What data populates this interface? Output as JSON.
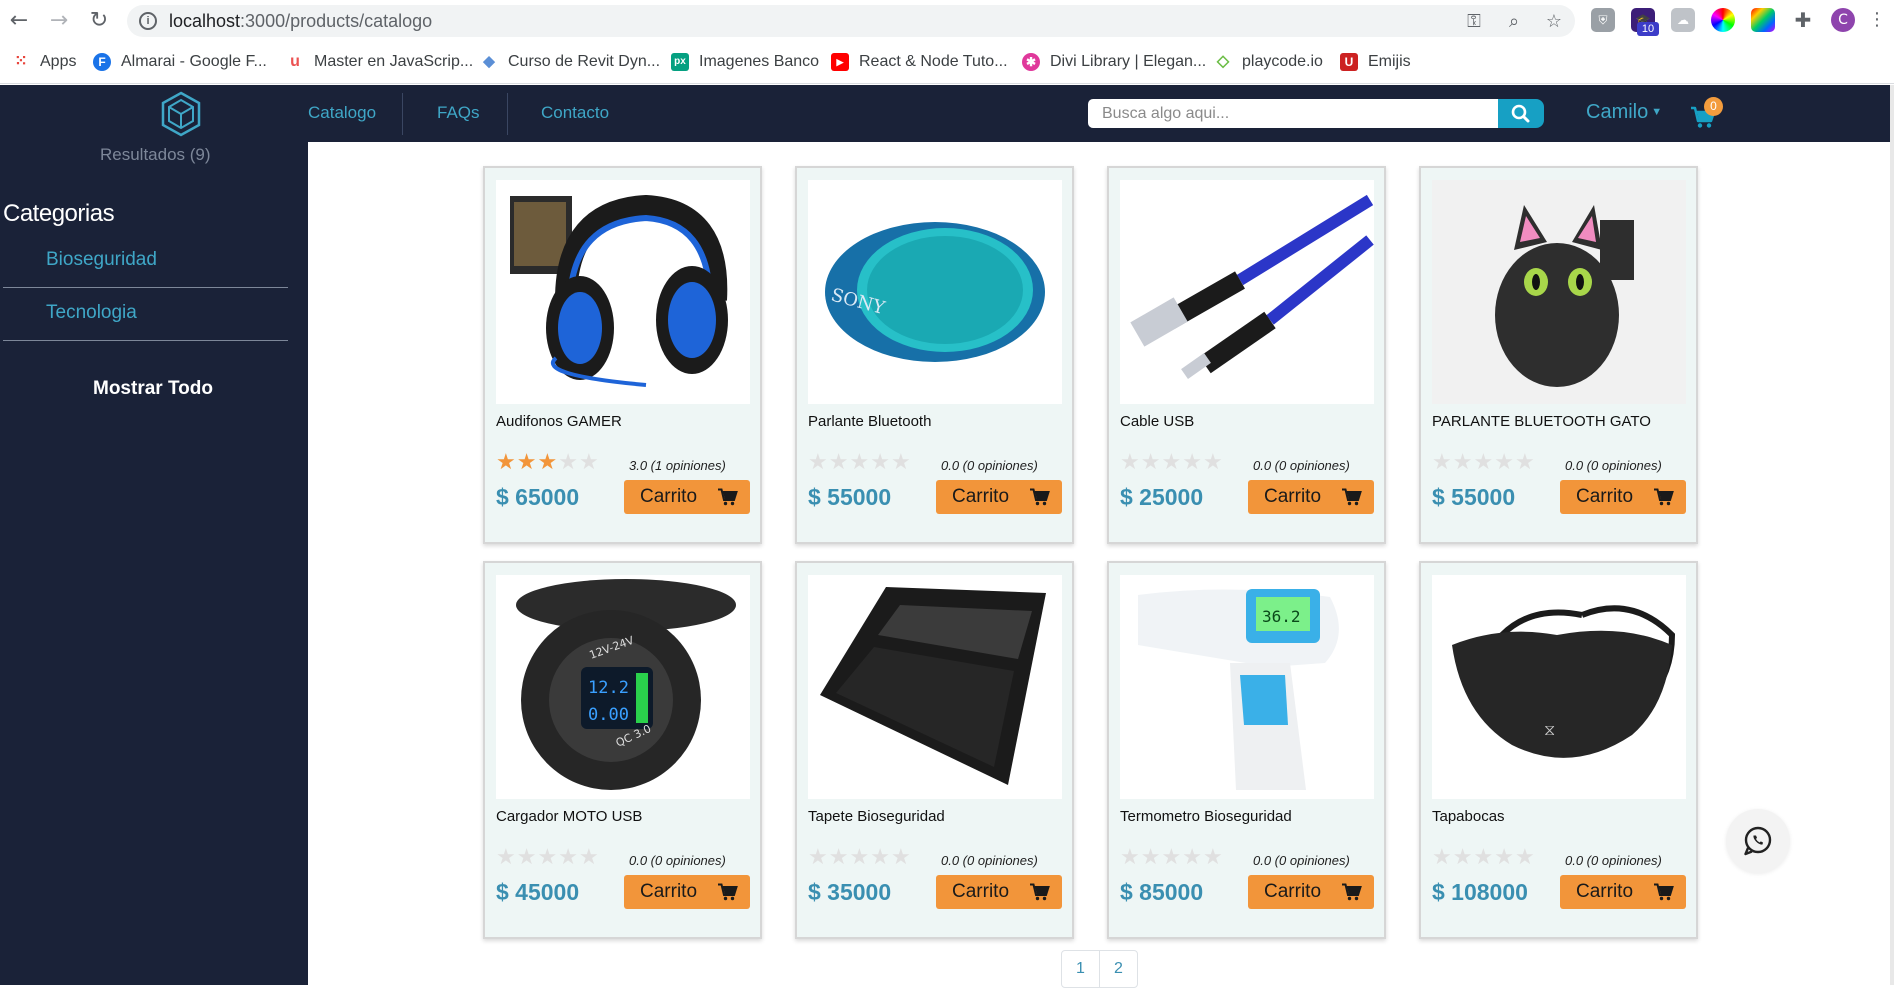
{
  "browser": {
    "url_host": "localhost",
    "url_path": ":3000/products/catalogo",
    "extension_badge": "10",
    "profile_initial": "C"
  },
  "bookmarks": [
    {
      "label": "Apps",
      "icon": "apps-grid-icon"
    },
    {
      "label": "Almarai - Google F...",
      "icon": "google-fonts-icon",
      "glyph": "F",
      "color": "#1a73e8"
    },
    {
      "label": "Master en JavaScrip...",
      "icon": "udemy-icon",
      "glyph": "u",
      "color": "#ec5252"
    },
    {
      "label": "Curso de Revit Dyn...",
      "icon": "dynamo-icon",
      "glyph": "◆",
      "color": "#5b8fd6"
    },
    {
      "label": "Imagenes Banco",
      "icon": "pexels-icon",
      "glyph": "px",
      "color": "#05a081"
    },
    {
      "label": "React & Node Tuto...",
      "icon": "youtube-icon",
      "glyph": "▶",
      "color": "#ff0000"
    },
    {
      "label": "Divi Library | Elegan...",
      "icon": "divi-icon",
      "glyph": "✱",
      "color": "#e0389b"
    },
    {
      "label": "playcode.io",
      "icon": "playcode-icon",
      "glyph": "◇",
      "color": "#6bbd45"
    },
    {
      "label": "Emijis",
      "icon": "unicode-icon",
      "glyph": "U",
      "color": "#d33"
    }
  ],
  "header": {
    "menu": [
      "Catalogo",
      "FAQs",
      "Contacto"
    ],
    "search_placeholder": "Busca algo aqui...",
    "user": "Camilo",
    "cart_count": "0"
  },
  "sidebar": {
    "results": "Resultados (9)",
    "title": "Categorias",
    "categories": [
      "Bioseguridad",
      "Tecnologia"
    ],
    "show_all": "Mostrar Todo"
  },
  "products": [
    {
      "name": "Audifonos GAMER",
      "rating_value": 3,
      "rating_text": "3.0 (1 opiniones)",
      "price": "$ 65000",
      "button": "Carrito",
      "image": "headset"
    },
    {
      "name": "Parlante Bluetooth",
      "rating_value": 0,
      "rating_text": "0.0 (0 opiniones)",
      "price": "$ 55000",
      "button": "Carrito",
      "image": "speaker"
    },
    {
      "name": "Cable USB",
      "rating_value": 0,
      "rating_text": "0.0 (0 opiniones)",
      "price": "$ 25000",
      "button": "Carrito",
      "image": "cable"
    },
    {
      "name": "PARLANTE BLUETOOTH GATO",
      "rating_value": 0,
      "rating_text": "0.0 (0 opiniones)",
      "price": "$ 55000",
      "button": "Carrito",
      "image": "cat-speaker"
    },
    {
      "name": "Cargador MOTO USB",
      "rating_value": 0,
      "rating_text": "0.0 (0 opiniones)",
      "price": "$ 45000",
      "button": "Carrito",
      "image": "moto-charger"
    },
    {
      "name": "Tapete Bioseguridad",
      "rating_value": 0,
      "rating_text": "0.0 (0 opiniones)",
      "price": "$ 35000",
      "button": "Carrito",
      "image": "mat"
    },
    {
      "name": "Termometro Bioseguridad",
      "rating_value": 0,
      "rating_text": "0.0 (0 opiniones)",
      "price": "$ 85000",
      "button": "Carrito",
      "image": "thermometer"
    },
    {
      "name": "Tapabocas",
      "rating_value": 0,
      "rating_text": "0.0 (0 opiniones)",
      "price": "$ 108000",
      "button": "Carrito",
      "image": "mask"
    }
  ],
  "product_image_text": {
    "speaker_brand": "SONY",
    "charger_voltage": "12V-24V",
    "charger_volts_reading": "12.2",
    "charger_amps_reading": "0.00",
    "charger_qc": "QC 3.0",
    "thermometer_reading": "36.2"
  },
  "pagination": [
    "1",
    "2"
  ],
  "colors": {
    "navbar": "#1a2238",
    "accent": "#3fa7c7",
    "button": "#f2953a",
    "price": "#3a8fb1",
    "card_bg": "#eef6f5"
  }
}
